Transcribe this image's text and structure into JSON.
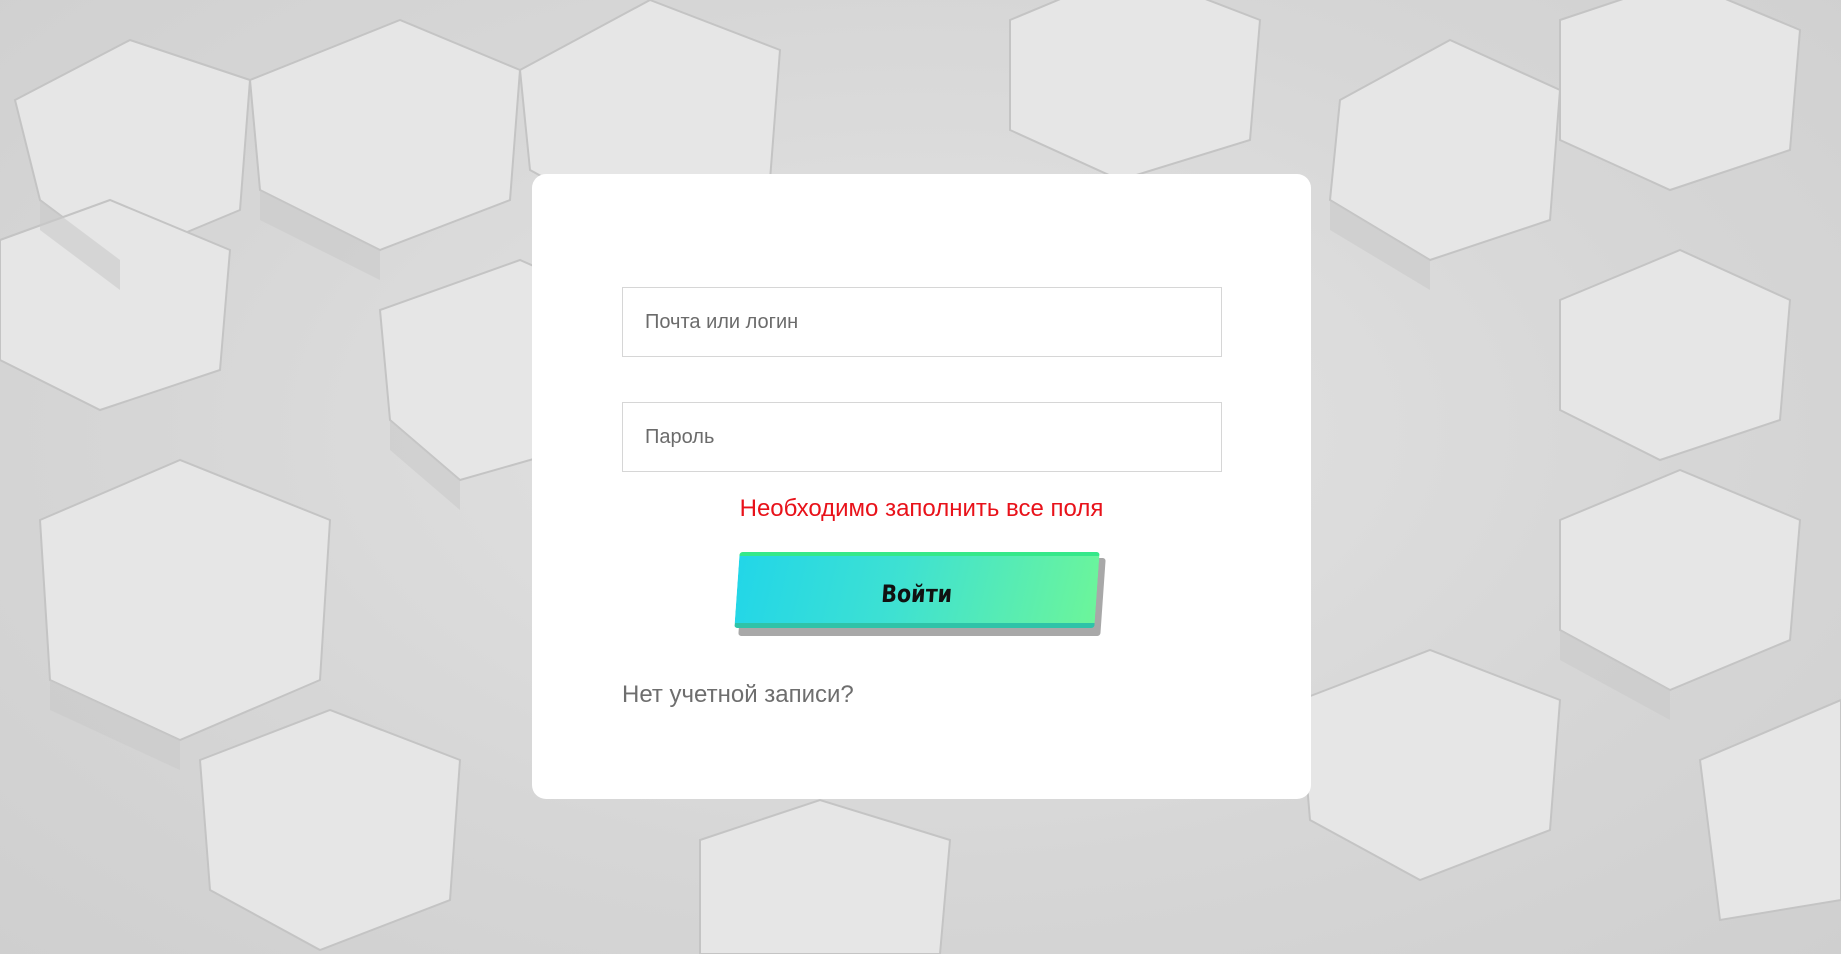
{
  "login_form": {
    "login_placeholder": "Почта или логин",
    "login_value": "",
    "password_placeholder": "Пароль",
    "password_value": "",
    "error_message": "Необходимо заполнить все поля",
    "submit_label": "Войти",
    "signup_link": "Нет учетной записи?"
  },
  "colors": {
    "error": "#e8121a",
    "button_gradient_start": "#22d6e8",
    "button_gradient_end": "#6cf59a",
    "card_background": "#ffffff",
    "page_background": "#d9d9d9"
  }
}
